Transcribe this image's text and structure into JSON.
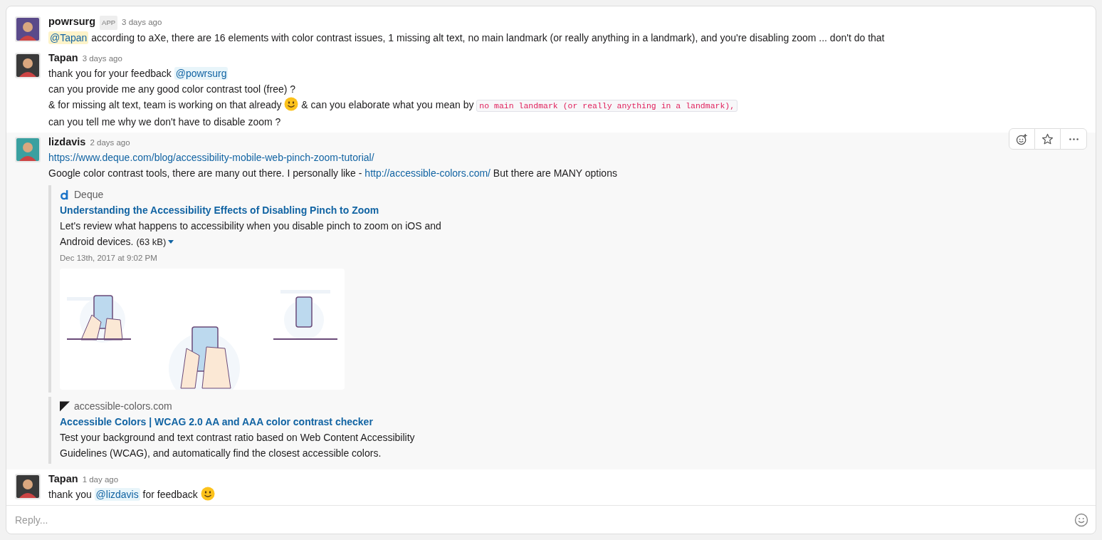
{
  "messages": [
    {
      "author": "powrsurg",
      "badge": "APP",
      "time": "3 days ago",
      "hovered": false,
      "lines": [
        [
          {
            "kind": "mention",
            "text": "@Tapan",
            "self": true
          },
          {
            "kind": "text",
            "text": " according to aXe, there are 16 elements with color contrast issues, 1 missing alt text, no main landmark (or really anything in a landmark), and you're disabling zoom ... don't do that"
          }
        ]
      ]
    },
    {
      "author": "Tapan",
      "time": "3 days ago",
      "hovered": false,
      "lines": [
        [
          {
            "kind": "text",
            "text": "thank you for your feedback "
          },
          {
            "kind": "mention",
            "text": "@powrsurg",
            "self": false
          }
        ],
        [
          {
            "kind": "text",
            "text": "can you provide me any good color contrast tool (free) ?"
          }
        ],
        [
          {
            "kind": "text",
            "text": "& for missing alt text, team is working on that already "
          },
          {
            "kind": "emoji"
          },
          {
            "kind": "text",
            "text": " & can you elaborate what you mean by "
          },
          {
            "kind": "code",
            "text": "no main landmark (or really anything in a landmark),"
          }
        ],
        [
          {
            "kind": "text",
            "text": "can you tell me why we don't have to disable zoom ?"
          }
        ]
      ]
    },
    {
      "author": "lizdavis",
      "time": "2 days ago",
      "hovered": true,
      "lines": [
        [
          {
            "kind": "link",
            "text": "https://www.deque.com/blog/accessibility-mobile-web-pinch-zoom-tutorial/"
          }
        ],
        [
          {
            "kind": "text",
            "text": "Google color contrast tools, there are many out there. I personally like - "
          },
          {
            "kind": "link",
            "text": "http://accessible-colors.com/"
          },
          {
            "kind": "text",
            "text": " But there are MANY options"
          }
        ]
      ],
      "attachments": [
        {
          "service": "Deque",
          "title": "Understanding the Accessibility Effects of Disabling Pinch to Zoom",
          "text_lines": [
            "Let's review what happens to accessibility when you disable pinch to zoom on iOS and",
            "Android devices."
          ],
          "size": "(63 kB)",
          "date": "Dec 13th, 2017 at 9:02 PM",
          "image": {
            "kind": "picture"
          }
        },
        {
          "service": "accessible-colors.com",
          "title": "Accessible Colors | WCAG 2.0 AA and AAA color contrast checker",
          "text_lines": [
            "Test your background and text contrast ratio based on Web Content Accessibility",
            "Guidelines (WCAG), and automatically find the closest accessible colors."
          ]
        }
      ]
    },
    {
      "author": "Tapan",
      "time": "1 day ago",
      "hovered": false,
      "lines": [
        [
          {
            "kind": "text",
            "text": "thank you "
          },
          {
            "kind": "mention",
            "text": "@lizdavis",
            "self": false
          },
          {
            "kind": "text",
            "text": " for feedback "
          },
          {
            "kind": "emoji"
          }
        ]
      ]
    }
  ],
  "composer": {
    "placeholder": "Reply..."
  }
}
